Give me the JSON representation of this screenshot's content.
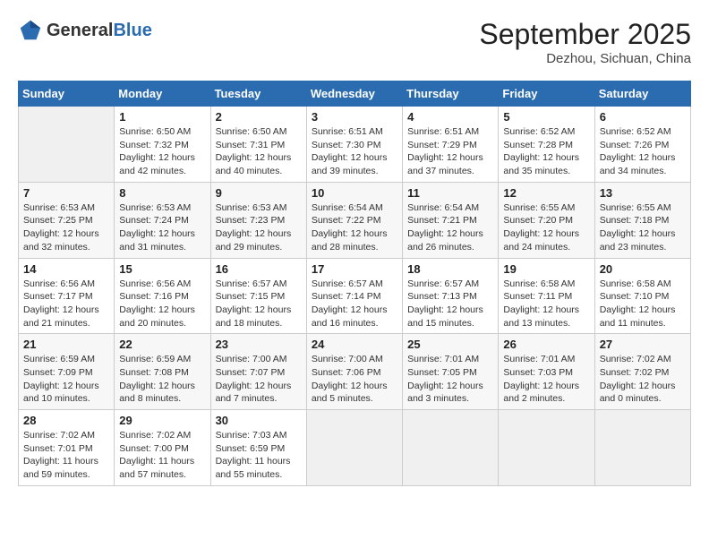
{
  "header": {
    "logo_general": "General",
    "logo_blue": "Blue",
    "month_year": "September 2025",
    "location": "Dezhou, Sichuan, China"
  },
  "weekdays": [
    "Sunday",
    "Monday",
    "Tuesday",
    "Wednesday",
    "Thursday",
    "Friday",
    "Saturday"
  ],
  "weeks": [
    [
      {
        "day": "",
        "sunrise": "",
        "sunset": "",
        "daylight": ""
      },
      {
        "day": "1",
        "sunrise": "Sunrise: 6:50 AM",
        "sunset": "Sunset: 7:32 PM",
        "daylight": "Daylight: 12 hours and 42 minutes."
      },
      {
        "day": "2",
        "sunrise": "Sunrise: 6:50 AM",
        "sunset": "Sunset: 7:31 PM",
        "daylight": "Daylight: 12 hours and 40 minutes."
      },
      {
        "day": "3",
        "sunrise": "Sunrise: 6:51 AM",
        "sunset": "Sunset: 7:30 PM",
        "daylight": "Daylight: 12 hours and 39 minutes."
      },
      {
        "day": "4",
        "sunrise": "Sunrise: 6:51 AM",
        "sunset": "Sunset: 7:29 PM",
        "daylight": "Daylight: 12 hours and 37 minutes."
      },
      {
        "day": "5",
        "sunrise": "Sunrise: 6:52 AM",
        "sunset": "Sunset: 7:28 PM",
        "daylight": "Daylight: 12 hours and 35 minutes."
      },
      {
        "day": "6",
        "sunrise": "Sunrise: 6:52 AM",
        "sunset": "Sunset: 7:26 PM",
        "daylight": "Daylight: 12 hours and 34 minutes."
      }
    ],
    [
      {
        "day": "7",
        "sunrise": "Sunrise: 6:53 AM",
        "sunset": "Sunset: 7:25 PM",
        "daylight": "Daylight: 12 hours and 32 minutes."
      },
      {
        "day": "8",
        "sunrise": "Sunrise: 6:53 AM",
        "sunset": "Sunset: 7:24 PM",
        "daylight": "Daylight: 12 hours and 31 minutes."
      },
      {
        "day": "9",
        "sunrise": "Sunrise: 6:53 AM",
        "sunset": "Sunset: 7:23 PM",
        "daylight": "Daylight: 12 hours and 29 minutes."
      },
      {
        "day": "10",
        "sunrise": "Sunrise: 6:54 AM",
        "sunset": "Sunset: 7:22 PM",
        "daylight": "Daylight: 12 hours and 28 minutes."
      },
      {
        "day": "11",
        "sunrise": "Sunrise: 6:54 AM",
        "sunset": "Sunset: 7:21 PM",
        "daylight": "Daylight: 12 hours and 26 minutes."
      },
      {
        "day": "12",
        "sunrise": "Sunrise: 6:55 AM",
        "sunset": "Sunset: 7:20 PM",
        "daylight": "Daylight: 12 hours and 24 minutes."
      },
      {
        "day": "13",
        "sunrise": "Sunrise: 6:55 AM",
        "sunset": "Sunset: 7:18 PM",
        "daylight": "Daylight: 12 hours and 23 minutes."
      }
    ],
    [
      {
        "day": "14",
        "sunrise": "Sunrise: 6:56 AM",
        "sunset": "Sunset: 7:17 PM",
        "daylight": "Daylight: 12 hours and 21 minutes."
      },
      {
        "day": "15",
        "sunrise": "Sunrise: 6:56 AM",
        "sunset": "Sunset: 7:16 PM",
        "daylight": "Daylight: 12 hours and 20 minutes."
      },
      {
        "day": "16",
        "sunrise": "Sunrise: 6:57 AM",
        "sunset": "Sunset: 7:15 PM",
        "daylight": "Daylight: 12 hours and 18 minutes."
      },
      {
        "day": "17",
        "sunrise": "Sunrise: 6:57 AM",
        "sunset": "Sunset: 7:14 PM",
        "daylight": "Daylight: 12 hours and 16 minutes."
      },
      {
        "day": "18",
        "sunrise": "Sunrise: 6:57 AM",
        "sunset": "Sunset: 7:13 PM",
        "daylight": "Daylight: 12 hours and 15 minutes."
      },
      {
        "day": "19",
        "sunrise": "Sunrise: 6:58 AM",
        "sunset": "Sunset: 7:11 PM",
        "daylight": "Daylight: 12 hours and 13 minutes."
      },
      {
        "day": "20",
        "sunrise": "Sunrise: 6:58 AM",
        "sunset": "Sunset: 7:10 PM",
        "daylight": "Daylight: 12 hours and 11 minutes."
      }
    ],
    [
      {
        "day": "21",
        "sunrise": "Sunrise: 6:59 AM",
        "sunset": "Sunset: 7:09 PM",
        "daylight": "Daylight: 12 hours and 10 minutes."
      },
      {
        "day": "22",
        "sunrise": "Sunrise: 6:59 AM",
        "sunset": "Sunset: 7:08 PM",
        "daylight": "Daylight: 12 hours and 8 minutes."
      },
      {
        "day": "23",
        "sunrise": "Sunrise: 7:00 AM",
        "sunset": "Sunset: 7:07 PM",
        "daylight": "Daylight: 12 hours and 7 minutes."
      },
      {
        "day": "24",
        "sunrise": "Sunrise: 7:00 AM",
        "sunset": "Sunset: 7:06 PM",
        "daylight": "Daylight: 12 hours and 5 minutes."
      },
      {
        "day": "25",
        "sunrise": "Sunrise: 7:01 AM",
        "sunset": "Sunset: 7:05 PM",
        "daylight": "Daylight: 12 hours and 3 minutes."
      },
      {
        "day": "26",
        "sunrise": "Sunrise: 7:01 AM",
        "sunset": "Sunset: 7:03 PM",
        "daylight": "Daylight: 12 hours and 2 minutes."
      },
      {
        "day": "27",
        "sunrise": "Sunrise: 7:02 AM",
        "sunset": "Sunset: 7:02 PM",
        "daylight": "Daylight: 12 hours and 0 minutes."
      }
    ],
    [
      {
        "day": "28",
        "sunrise": "Sunrise: 7:02 AM",
        "sunset": "Sunset: 7:01 PM",
        "daylight": "Daylight: 11 hours and 59 minutes."
      },
      {
        "day": "29",
        "sunrise": "Sunrise: 7:02 AM",
        "sunset": "Sunset: 7:00 PM",
        "daylight": "Daylight: 11 hours and 57 minutes."
      },
      {
        "day": "30",
        "sunrise": "Sunrise: 7:03 AM",
        "sunset": "Sunset: 6:59 PM",
        "daylight": "Daylight: 11 hours and 55 minutes."
      },
      {
        "day": "",
        "sunrise": "",
        "sunset": "",
        "daylight": ""
      },
      {
        "day": "",
        "sunrise": "",
        "sunset": "",
        "daylight": ""
      },
      {
        "day": "",
        "sunrise": "",
        "sunset": "",
        "daylight": ""
      },
      {
        "day": "",
        "sunrise": "",
        "sunset": "",
        "daylight": ""
      }
    ]
  ]
}
